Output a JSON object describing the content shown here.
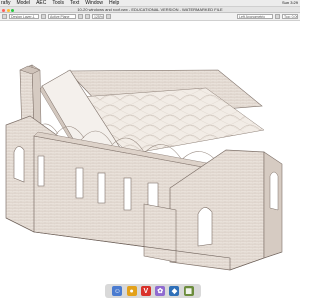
{
  "menubar": {
    "items": [
      "rafiy",
      "Model",
      "AEC",
      "Tools",
      "Text",
      "Window",
      "Help"
    ],
    "status": "Sun 3:29"
  },
  "window": {
    "title": "10-20 windows and roof.vwx - EDUCATIONAL VERSION - WATERMARKED FILE"
  },
  "toolbar": {
    "layer": "Design Layer-1",
    "plane": "Active Plane",
    "view": "Left Axonometric",
    "zoom": "125%",
    "scale": "Top: 0.00\""
  },
  "dock": {
    "apps": [
      {
        "icon": "finder-icon",
        "color": "#4a7bd0",
        "glyph": "☺"
      },
      {
        "icon": "chrome-icon",
        "color": "#e3a11a",
        "glyph": "●"
      },
      {
        "icon": "vivaldi-icon",
        "color": "#d9322b",
        "glyph": "V"
      },
      {
        "icon": "photos-icon",
        "color": "#8f6ad0",
        "glyph": "✿"
      },
      {
        "icon": "vectorworks-icon",
        "color": "#2e6fb8",
        "glyph": "◆"
      },
      {
        "icon": "apps-icon",
        "color": "#6b8c3c",
        "glyph": "▦"
      }
    ]
  }
}
